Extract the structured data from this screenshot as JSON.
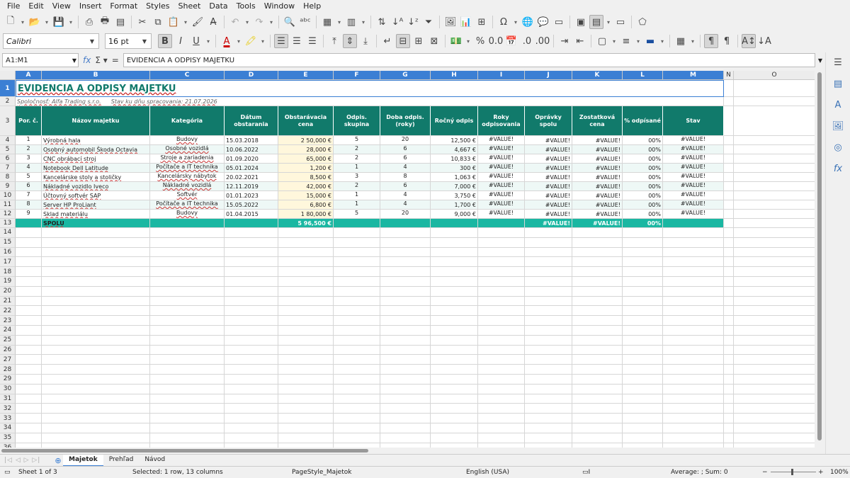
{
  "menu": [
    "File",
    "Edit",
    "View",
    "Insert",
    "Format",
    "Styles",
    "Sheet",
    "Data",
    "Tools",
    "Window",
    "Help"
  ],
  "font": {
    "name": "Calibri",
    "size": "16 pt"
  },
  "formula": {
    "namebox": "A1:M1",
    "content": "EVIDENCIA A ODPISY MAJETKU"
  },
  "columns": [
    "A",
    "B",
    "C",
    "D",
    "E",
    "F",
    "G",
    "H",
    "I",
    "J",
    "K",
    "L",
    "M",
    "N",
    "O"
  ],
  "rows": [
    "1",
    "2",
    "3",
    "4",
    "5",
    "6",
    "7",
    "8",
    "9",
    "10",
    "11",
    "12",
    "13",
    "14",
    "15",
    "16",
    "17",
    "18",
    "19",
    "20",
    "21",
    "22",
    "23",
    "24",
    "25",
    "26",
    "27",
    "28",
    "29",
    "30",
    "31",
    "32",
    "33",
    "34",
    "35",
    "36"
  ],
  "sheet": {
    "title": "EVIDENCIA A ODPISY MAJETKU",
    "company": "Spoločnosť: Alfa Trading s.r.o.",
    "date_label": "Stav ku dňu spracovania: 21.07.2026",
    "headers": [
      "Por. č.",
      "Názov majetku",
      "Kategória",
      "Dátum obstarania",
      "Obstarávacia cena",
      "Odpis. skupina",
      "Doba odpis. (roky)",
      "Ročný odpis",
      "Roky odpisovania",
      "Oprávky spolu",
      "Zostatková cena",
      "% odpísané",
      "Stav"
    ],
    "data": [
      [
        "1",
        "Výrobná hala",
        "Budovy",
        "15.03.2018",
        "2 50,000 €",
        "5",
        "20",
        "12,500 €",
        "#VALUE!",
        "#VALUE!",
        "#VALUE!",
        "00%",
        "#VALUE!"
      ],
      [
        "2",
        "Osobný automobil Škoda Octavia",
        "Osobné vozidlá",
        "10.06.2022",
        "28,000 €",
        "2",
        "6",
        "4,667 €",
        "#VALUE!",
        "#VALUE!",
        "#VALUE!",
        "00%",
        "#VALUE!"
      ],
      [
        "3",
        "CNC obrábací stroj",
        "Stroje a zariadenia",
        "01.09.2020",
        "65,000 €",
        "2",
        "6",
        "10,833 €",
        "#VALUE!",
        "#VALUE!",
        "#VALUE!",
        "00%",
        "#VALUE!"
      ],
      [
        "4",
        "Notebook Dell Latitude",
        "Počítače a IT technika",
        "05.01.2024",
        "1,200 €",
        "1",
        "4",
        "300 €",
        "#VALUE!",
        "#VALUE!",
        "#VALUE!",
        "00%",
        "#VALUE!"
      ],
      [
        "5",
        "Kancelárske stoly a stoličky",
        "Kancelársky nábytok",
        "20.02.2021",
        "8,500 €",
        "3",
        "8",
        "1,063 €",
        "#VALUE!",
        "#VALUE!",
        "#VALUE!",
        "00%",
        "#VALUE!"
      ],
      [
        "6",
        "Nákladné vozidlo Iveco",
        "Nákladné vozidlá",
        "12.11.2019",
        "42,000 €",
        "2",
        "6",
        "7,000 €",
        "#VALUE!",
        "#VALUE!",
        "#VALUE!",
        "00%",
        "#VALUE!"
      ],
      [
        "7",
        "Účtovný softvér SAP",
        "Softvér",
        "01.01.2023",
        "15,000 €",
        "1",
        "4",
        "3,750 €",
        "#VALUE!",
        "#VALUE!",
        "#VALUE!",
        "00%",
        "#VALUE!"
      ],
      [
        "8",
        "Server HP ProLiant",
        "Počítače a IT technika",
        "15.05.2022",
        "6,800 €",
        "1",
        "4",
        "1,700 €",
        "#VALUE!",
        "#VALUE!",
        "#VALUE!",
        "00%",
        "#VALUE!"
      ],
      [
        "9",
        "Sklad materiálu",
        "Budovy",
        "01.04.2015",
        "1 80,000 €",
        "5",
        "20",
        "9,000 €",
        "#VALUE!",
        "#VALUE!",
        "#VALUE!",
        "00%",
        "#VALUE!"
      ]
    ],
    "total": {
      "label": "SPOLU",
      "cost": "5 96,500 €",
      "accum": "#VALUE!",
      "residual": "#VALUE!",
      "pct": "00%"
    }
  },
  "tabs": [
    "Majetok",
    "Prehľad",
    "Návod"
  ],
  "status": {
    "sheet": "Sheet 1 of 3",
    "selection": "Selected: 1 row, 13 columns",
    "pagestyle": "PageStyle_Majetok",
    "lang": "English (USA)",
    "sum": "Average: ; Sum: 0",
    "zoom": "100%"
  },
  "colors": {
    "header": "#117a6b",
    "total": "#1ab7a2",
    "selection": "#3b7fd4"
  }
}
